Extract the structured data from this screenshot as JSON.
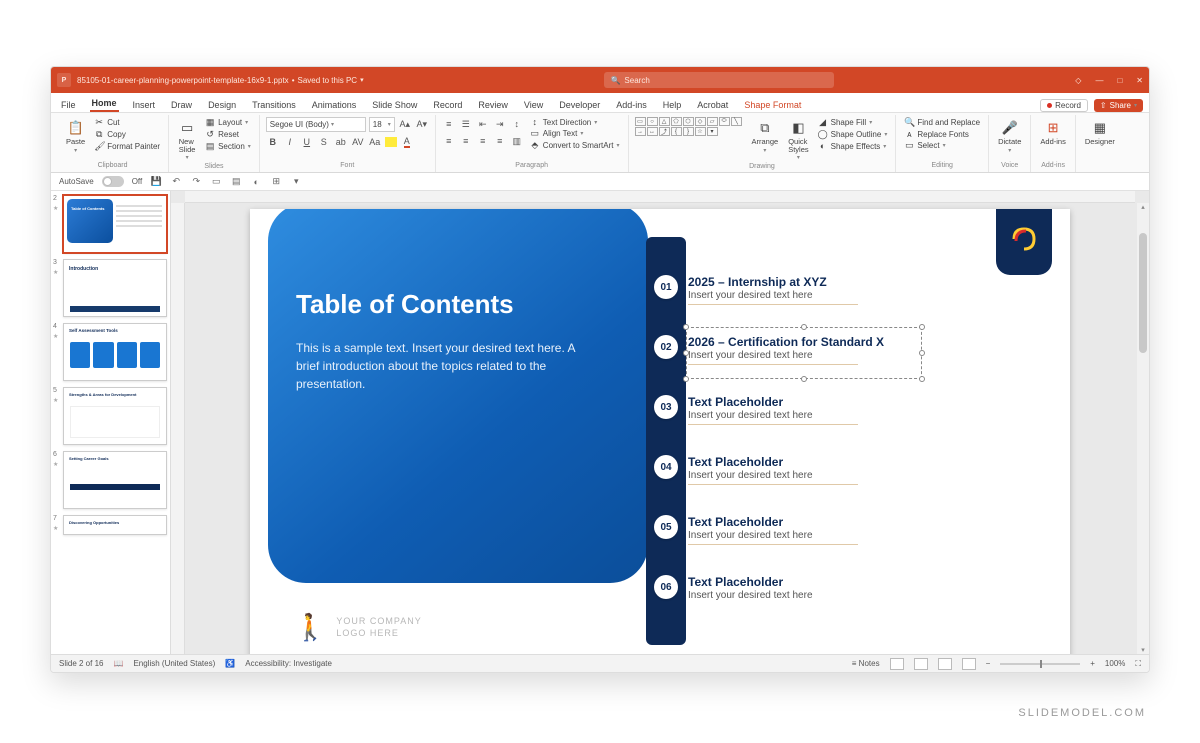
{
  "title": {
    "filename": "85105-01-career-planning-powerpoint-template-16x9-1.pptx",
    "save_status": "Saved to this PC",
    "search_placeholder": "Search"
  },
  "menutabs": {
    "file": "File",
    "home": "Home",
    "insert": "Insert",
    "draw": "Draw",
    "design": "Design",
    "transitions": "Transitions",
    "animations": "Animations",
    "slideshow": "Slide Show",
    "record": "Record",
    "review": "Review",
    "view": "View",
    "developer": "Developer",
    "addins": "Add-ins",
    "help": "Help",
    "acrobat": "Acrobat",
    "shapeformat": "Shape Format",
    "record_btn": "Record",
    "share_btn": "Share"
  },
  "ribbon": {
    "clipboard": {
      "paste": "Paste",
      "cut": "Cut",
      "copy": "Copy",
      "format_painter": "Format Painter",
      "label": "Clipboard"
    },
    "slides": {
      "new_slide": "New\nSlide",
      "layout": "Layout",
      "reset": "Reset",
      "section": "Section",
      "label": "Slides"
    },
    "font": {
      "name": "Segoe UI (Body)",
      "size": "18",
      "label": "Font"
    },
    "paragraph": {
      "text_direction": "Text Direction",
      "align_text": "Align Text",
      "convert_smartart": "Convert to SmartArt",
      "label": "Paragraph"
    },
    "drawing": {
      "arrange": "Arrange",
      "quick_styles": "Quick\nStyles",
      "shape_fill": "Shape Fill",
      "shape_outline": "Shape Outline",
      "shape_effects": "Shape Effects",
      "label": "Drawing"
    },
    "editing": {
      "find": "Find and Replace",
      "replace": "Replace Fonts",
      "select": "Select",
      "label": "Editing"
    },
    "voice": {
      "dictate": "Dictate",
      "label": "Voice"
    },
    "addins_grp": {
      "addins": "Add-ins",
      "label": "Add-ins"
    },
    "designer": {
      "designer": "Designer"
    }
  },
  "qat": {
    "autosave": "AutoSave",
    "off": "Off"
  },
  "thumbs": [
    {
      "n": "2",
      "title": "Table of Contents"
    },
    {
      "n": "3",
      "title": "Introduction"
    },
    {
      "n": "4",
      "title": "Self Assessment Tools"
    },
    {
      "n": "5",
      "title": "Strengths & Areas for Development"
    },
    {
      "n": "6",
      "title": "Setting Career Goals"
    },
    {
      "n": "7",
      "title": "Discovering Opportunities"
    }
  ],
  "slide": {
    "title": "Table of Contents",
    "desc": "This is a sample text. Insert your desired text here. A brief introduction about the topics related to the presentation.",
    "items": [
      {
        "num": "01",
        "h": "2025 – Internship at XYZ",
        "p": "Insert your desired text here"
      },
      {
        "num": "02",
        "h": "2026 – Certification for Standard X",
        "p": "Insert your desired text here"
      },
      {
        "num": "03",
        "h": "Text Placeholder",
        "p": "Insert your desired text here"
      },
      {
        "num": "04",
        "h": "Text Placeholder",
        "p": "Insert your desired text here"
      },
      {
        "num": "05",
        "h": "Text Placeholder",
        "p": "Insert your desired text here"
      },
      {
        "num": "06",
        "h": "Text Placeholder",
        "p": "Insert your desired text here"
      }
    ],
    "company_logo_line1": "YOUR COMPANY",
    "company_logo_line2": "LOGO HERE"
  },
  "status": {
    "slide_n": "Slide 2 of 16",
    "language": "English (United States)",
    "accessibility": "Accessibility: Investigate",
    "notes": "Notes",
    "zoom": "100%"
  },
  "watermark": "SLIDEMODEL.COM"
}
